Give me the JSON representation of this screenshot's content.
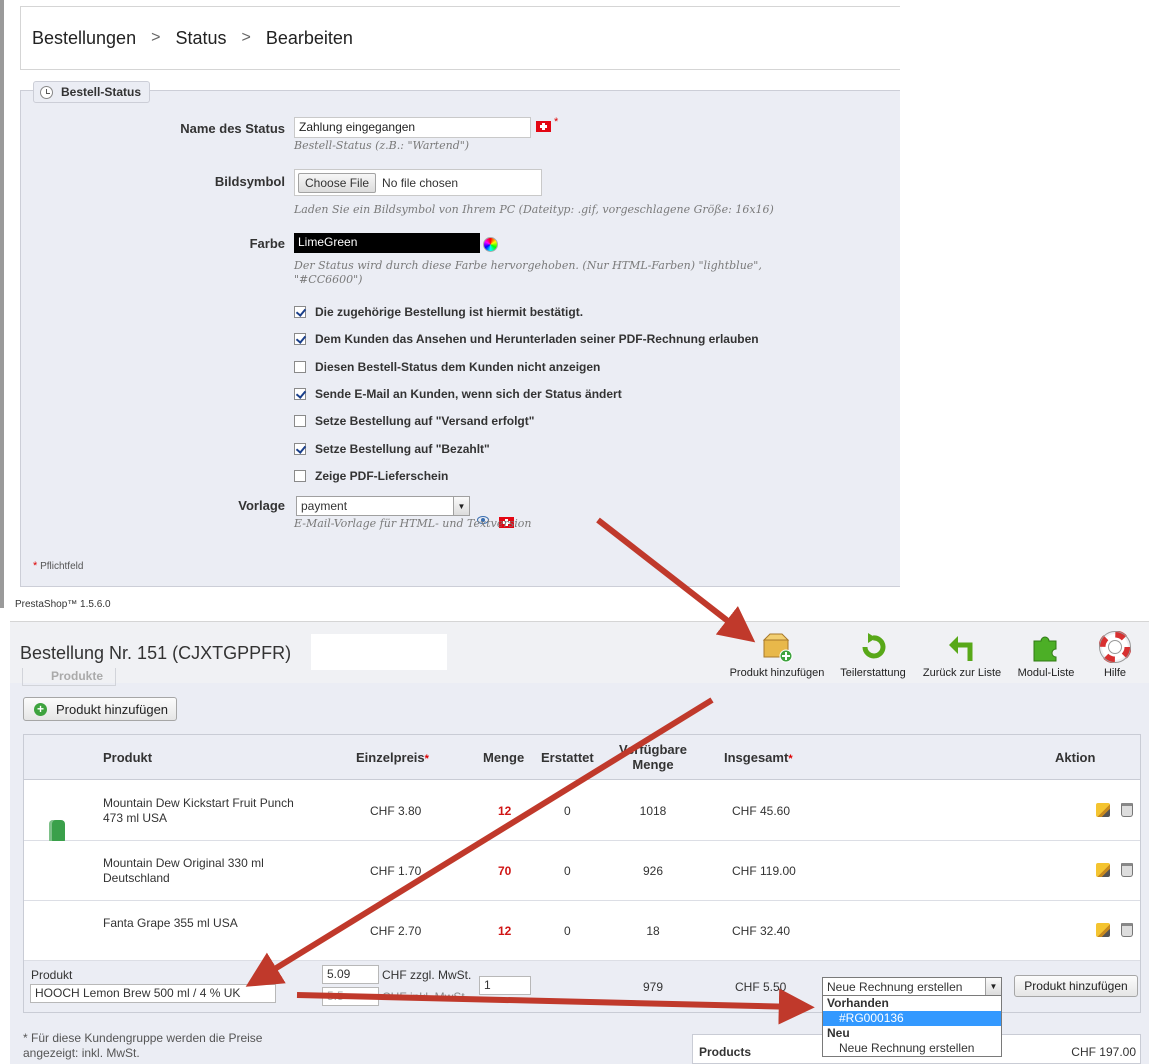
{
  "breadcrumb": [
    "Bestellungen",
    "Status",
    "Bearbeiten"
  ],
  "breadcrumb_sep": ">",
  "status_form": {
    "legend": "Bestell-Status",
    "name_label": "Name des Status",
    "name_value": "Zahlung eingegangen",
    "name_hint": "Bestell-Status (z.B.: \"Wartend\")",
    "required_star": "*",
    "icon_label": "Bildsymbol",
    "file_button": "Choose File",
    "file_status": "No file chosen",
    "icon_hint": "Laden Sie ein Bildsymbol von Ihrem PC (Dateityp: .gif, vorgeschlagene Größe: 16x16)",
    "color_label": "Farbe",
    "color_value": "LimeGreen",
    "color_hint": "Der Status wird durch diese Farbe hervorgehoben. (Nur HTML-Farben) \"lightblue\", \"#CC6600\")",
    "checkboxes": [
      {
        "label": "Die zugehörige Bestellung ist hiermit bestätigt.",
        "checked": true
      },
      {
        "label": "Dem Kunden das Ansehen und Herunterladen seiner PDF-Rechnung erlauben",
        "checked": true
      },
      {
        "label": "Diesen Bestell-Status dem Kunden nicht anzeigen",
        "checked": false
      },
      {
        "label": "Sende E-Mail an Kunden, wenn sich der Status ändert",
        "checked": true
      },
      {
        "label": "Setze Bestellung auf \"Versand erfolgt\"",
        "checked": false
      },
      {
        "label": "Setze Bestellung auf \"Bezahlt\"",
        "checked": true
      },
      {
        "label": "Zeige PDF-Lieferschein",
        "checked": false
      }
    ],
    "template_label": "Vorlage",
    "template_value": "payment",
    "template_hint": "E-Mail-Vorlage für HTML- und Textversion",
    "required_note": "Pflichtfeld"
  },
  "footer_version": "PrestaShop™ 1.5.6.0",
  "order": {
    "title": "Bestellung Nr. 151 (CJXTGPPFR)",
    "tab_label": "Produkte",
    "toolbar": [
      {
        "label": "Produkt hinzufügen",
        "icon": "box-add-icon"
      },
      {
        "label": "Teilerstattung",
        "icon": "refresh-icon"
      },
      {
        "label": "Zurück zur Liste",
        "icon": "back-arrow-icon"
      },
      {
        "label": "Modul-Liste",
        "icon": "puzzle-icon"
      },
      {
        "label": "Hilfe",
        "icon": "lifebuoy-icon"
      }
    ],
    "add_product_button": "Produkt hinzufügen",
    "columns": {
      "product": "Produkt",
      "unit_price": "Einzelpreis",
      "qty": "Menge",
      "refunded": "Erstattet",
      "available_1": "Verfügbare",
      "available_2": "Menge",
      "total": "Insgesamt",
      "action": "Aktion"
    },
    "products": [
      {
        "name": "Mountain Dew Kickstart Fruit Punch 473 ml USA",
        "price": "CHF 3.80",
        "qty": "12",
        "refunded": "0",
        "available": "1018",
        "total": "CHF 45.60",
        "can_color": "#3aa04a"
      },
      {
        "name": "Mountain Dew Original 330 ml Deutschland",
        "price": "CHF 1.70",
        "qty": "70",
        "refunded": "0",
        "available": "926",
        "total": "CHF 119.00",
        "can_color": "#1f5a22"
      },
      {
        "name": "Fanta Grape 355 ml USA",
        "price": "CHF 2.70",
        "qty": "12",
        "refunded": "0",
        "available": "18",
        "total": "CHF 32.40",
        "can_color": "#6a2a8a"
      }
    ],
    "new_row": {
      "label": "Produkt",
      "product_value": "HOOCH Lemon Brew 500 ml / 4 % UK",
      "price_excl": "5.09",
      "price_excl_label": "CHF zzgl. MwSt.",
      "price_incl": "5.5",
      "price_incl_label": "CHF inkl. MwSt.",
      "qty": "1",
      "available": "979",
      "total": "CHF 5.50",
      "invoice_select": "Neue Rechnung erstellen",
      "dropdown": [
        {
          "text": "Vorhanden",
          "type": "group"
        },
        {
          "text": "#RG000136",
          "type": "option",
          "selected": true
        },
        {
          "text": "Neu",
          "type": "group"
        },
        {
          "text": "Neue Rechnung erstellen",
          "type": "option",
          "selected": false
        }
      ],
      "add_button": "Produkt hinzufügen"
    },
    "price_note": "* Für diese Kundengruppe werden die Preise angezeigt: inkl. MwSt.",
    "totals_label": "Products",
    "totals_value": "CHF 197.00"
  },
  "colors": {
    "panel_bg": "#ebedf4",
    "arrow": "#c0392b",
    "qty_red": "#d01515"
  }
}
